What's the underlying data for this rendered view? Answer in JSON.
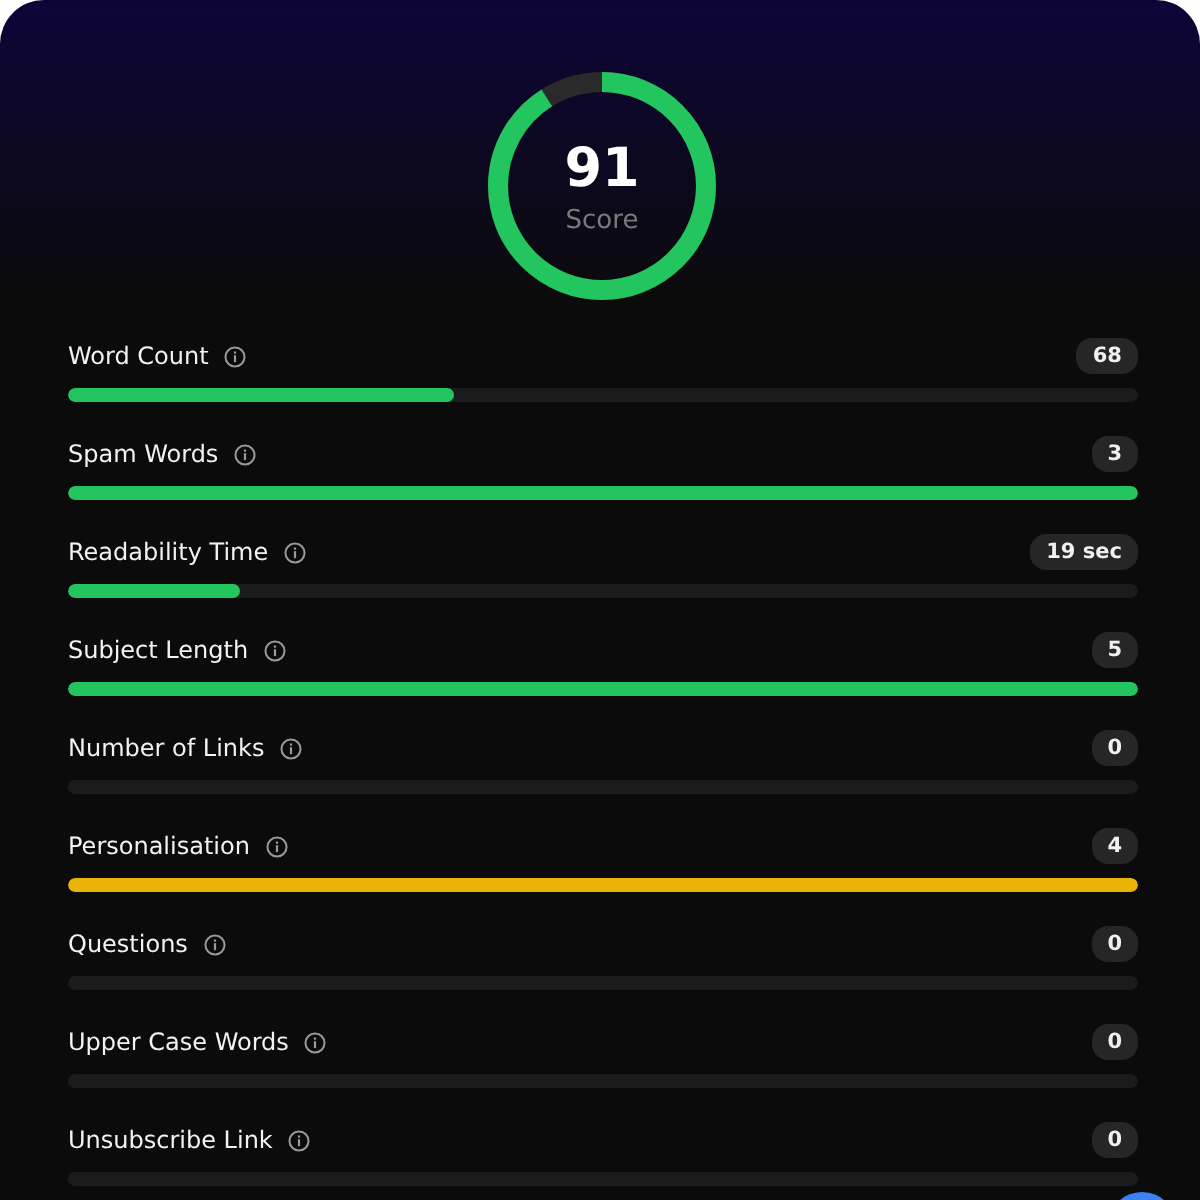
{
  "score": {
    "value": "91",
    "label": "Score",
    "level": 0.91
  },
  "metrics": [
    {
      "name": "Word Count",
      "value": "68",
      "level": 0.36,
      "color": "#22c55e"
    },
    {
      "name": "Spam Words",
      "value": "3",
      "level": 1,
      "color": "#22c55e"
    },
    {
      "name": "Readability Time",
      "value": "19 sec",
      "level": 0.16,
      "color": "#22c55e"
    },
    {
      "name": "Subject Length",
      "value": "5",
      "level": 1,
      "color": "#22c55e"
    },
    {
      "name": "Number of Links",
      "value": "0",
      "level": 0
    },
    {
      "name": "Personalisation",
      "value": "4",
      "level": 1,
      "color": "#eab308"
    },
    {
      "name": "Questions",
      "value": "0",
      "level": 0
    },
    {
      "name": "Upper Case Words",
      "value": "0",
      "level": 0
    },
    {
      "name": "Unsubscribe Link",
      "value": "0",
      "level": 0
    }
  ]
}
